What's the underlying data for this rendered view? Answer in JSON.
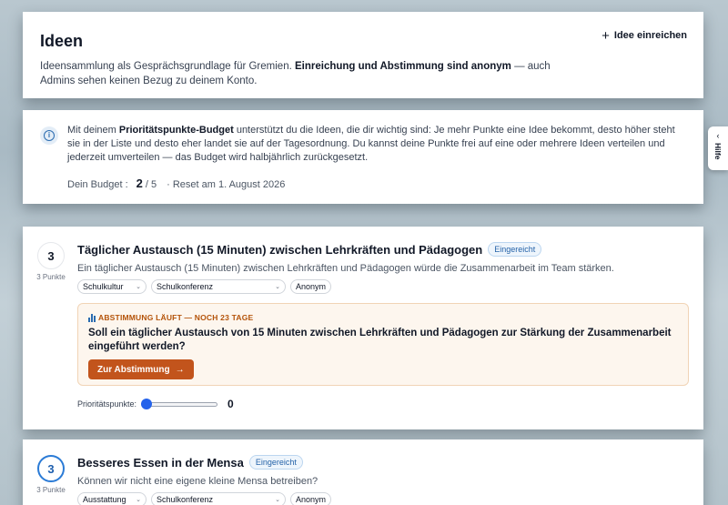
{
  "header": {
    "title": "Ideen",
    "desc_part1": "Ideensammlung als Gesprächsgrundlage für Gremien. ",
    "desc_bold": "Einreichung und Abstimmung sind anonym",
    "desc_part2": " — auch Admins sehen keinen Bezug zu deinem Konto.",
    "submit_label": "Idee einreichen"
  },
  "info": {
    "text_part1": "Mit deinem ",
    "text_bold": "Prioritätspunkte-Budget",
    "text_part2": " unterstützt du die Ideen, die dir wichtig sind: Je mehr Punkte eine Idee bekommt, desto höher steht sie in der Liste und desto eher landet sie auf der Tagesordnung. Du kannst deine Punkte frei auf eine oder mehrere Ideen verteilen und jederzeit umverteilen — das Budget wird halbjährlich zurückgesetzt.",
    "budget_label": "Dein Budget :",
    "budget_used": "2",
    "budget_total": "/ 5",
    "reset_text": "· Reset am 1. August 2026"
  },
  "ideas": [
    {
      "points": "3",
      "points_label": "3 Punkte",
      "title": "Täglicher Austausch (15 Minuten) zwischen Lehrkräften und Pädagogen",
      "status": "Eingereicht",
      "desc": "Ein täglicher Austausch (15 Minuten) zwischen Lehrkräften und Pädagogen würde die Zusammenarbeit im Team stärken.",
      "category": "Schulkultur",
      "committee": "Schulkonferenz",
      "anon": "Anonym",
      "vote_status": "ABSTIMMUNG LÄUFT — NOCH 23 TAGE",
      "vote_question": "Soll ein täglicher Austausch von 15 Minuten zwischen Lehrkräften und Pädagogen zur Stärkung der Zusammenarbeit eingeführt werden?",
      "vote_button": "Zur Abstimmung",
      "priority_label": "Prioritätspunkte:",
      "priority_value": "0"
    },
    {
      "points": "3",
      "points_label": "3 Punkte",
      "title": "Besseres Essen in der Mensa",
      "status": "Eingereicht",
      "desc": "Können wir nicht eine eigene kleine Mensa betreiben?",
      "category": "Ausstattung",
      "committee": "Schulkonferenz",
      "anon": "Anonym"
    }
  ],
  "help_tab": {
    "label": "Hilfe"
  },
  "icons": {
    "submit": "plus-icon",
    "info": "info-icon",
    "dropdown": "chevron-down-icon",
    "vote_status": "bar-chart-icon",
    "vote_button": "arrow-right-icon",
    "help": "chevron-left-icon"
  },
  "colors": {
    "accent": "#2563eb",
    "vote_button": "#c2541c",
    "vote_status": "#b45309",
    "badge": "#2563a8"
  }
}
